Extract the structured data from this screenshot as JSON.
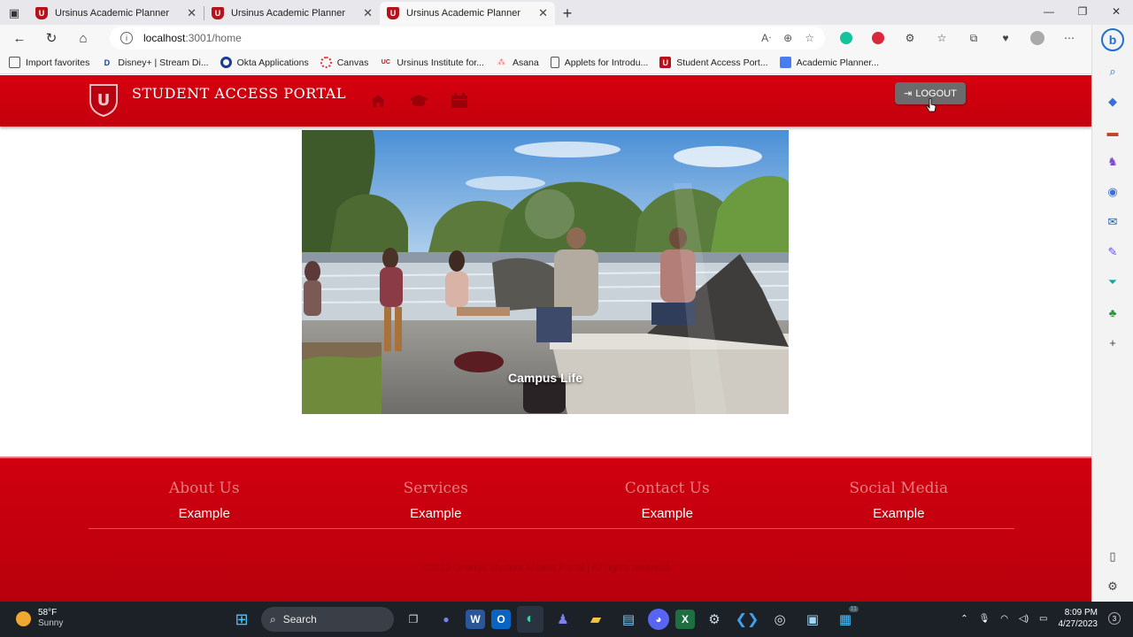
{
  "browser": {
    "tabs": [
      {
        "title": "Ursinus Academic Planner",
        "active": false
      },
      {
        "title": "Ursinus Academic Planner",
        "active": false
      },
      {
        "title": "Ursinus Academic Planner",
        "active": true
      }
    ],
    "address": {
      "host": "localhost",
      "path": ":3001/home"
    },
    "favorites": [
      {
        "label": "Import favorites",
        "icon": "import-icon"
      },
      {
        "label": "Disney+ | Stream Di...",
        "icon": "disney-icon"
      },
      {
        "label": "Okta Applications",
        "icon": "okta-icon"
      },
      {
        "label": "Canvas",
        "icon": "canvas-icon"
      },
      {
        "label": "Ursinus Institute for...",
        "icon": "ursinus-institute-icon"
      },
      {
        "label": "Asana",
        "icon": "asana-icon"
      },
      {
        "label": "Applets for Introdu...",
        "icon": "document-icon"
      },
      {
        "label": "Student Access Port...",
        "icon": "ursinus-shield-icon"
      },
      {
        "label": "Academic Planner...",
        "icon": "docs-icon"
      }
    ]
  },
  "site": {
    "logo_letter": "U",
    "title": "STUDENT ACCESS PORTAL",
    "nav": [
      "home-icon",
      "graduation-cap-icon",
      "calendar-icon"
    ],
    "logout_label": "LOGOUT",
    "hero_caption": "Campus Life",
    "footer": {
      "columns": [
        {
          "heading": "About Us",
          "link": "Example"
        },
        {
          "heading": "Services",
          "link": "Example"
        },
        {
          "heading": "Contact Us",
          "link": "Example"
        },
        {
          "heading": "Social Media",
          "link": "Example"
        }
      ],
      "copyright": "©2023 Ursinus Student Access Portal | All rights reserved"
    },
    "colors": {
      "brand_red": "#c8000e",
      "footer_heading": "#ee7a80"
    }
  },
  "taskbar": {
    "weather_temp": "58°F",
    "weather_desc": "Sunny",
    "search_label": "Search",
    "time": "8:09 PM",
    "date": "4/27/2023",
    "notification_count": "3",
    "teams_badge": "11"
  }
}
